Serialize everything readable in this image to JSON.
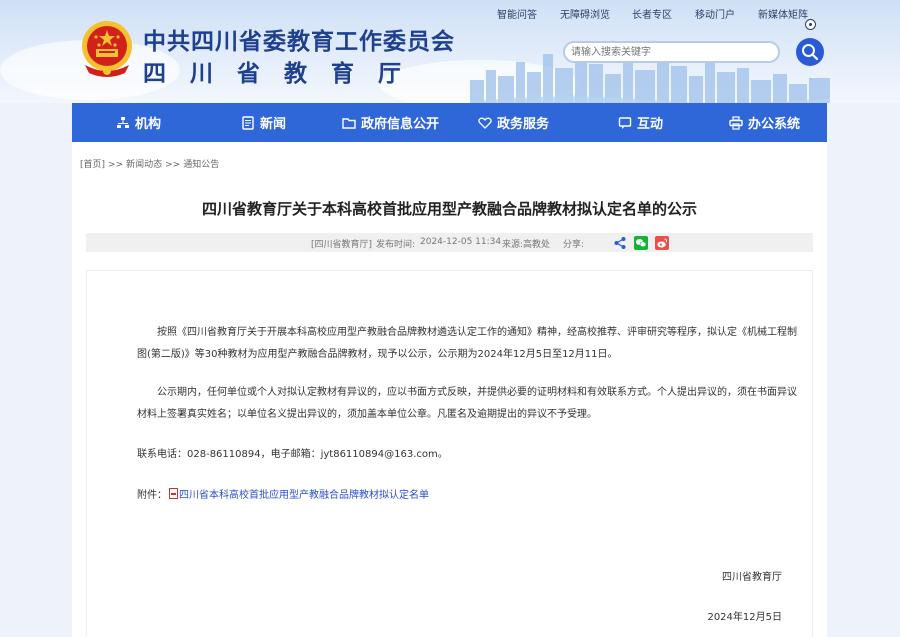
{
  "header": {
    "title": "中共四川省委教育工作委员会",
    "subtitle": "四川省教育厅",
    "top_links": [
      "智能问答",
      "无障碍浏览",
      "长者专区",
      "移动门户",
      "新媒体矩阵"
    ],
    "search_placeholder": "请输入搜索关键字"
  },
  "nav": {
    "items": [
      {
        "label": "机构",
        "icon": "org-icon"
      },
      {
        "label": "新闻",
        "icon": "news-icon"
      },
      {
        "label": "政府信息公开",
        "icon": "folder-icon"
      },
      {
        "label": "政务服务",
        "icon": "service-icon"
      },
      {
        "label": "互动",
        "icon": "chat-icon"
      },
      {
        "label": "办公系统",
        "icon": "printer-icon"
      }
    ]
  },
  "breadcrumb": [
    "[首页]",
    ">>",
    "新闻动态",
    ">>",
    "通知公告"
  ],
  "article": {
    "title": "四川省教育厅关于本科高校首批应用型产教融合品牌教材拟认定名单的公示",
    "source": "[四川省教育厅]",
    "publish_label": "发布时间:",
    "publish_time": "2024-12-05 11:34",
    "origin": "来源:高教处",
    "share_label": "分享:",
    "paragraphs": [
      "按照《四川省教育厅关于开展本科高校应用型产教融合品牌教材遴选认定工作的通知》精神，经高校推荐、评审研究等程序，拟认定《机械工程制图(第二版)》等30种教材为应用型产教融合品牌教材，现予以公示，公示期为2024年12月5日至12月11日。",
      "公示期内，任何单位或个人对拟认定教材有异议的，应以书面方式反映，并提供必要的证明材料和有效联系方式。个人提出异议的，须在书面异议材料上签署真实姓名；以单位名义提出异议的，须加盖本单位公章。凡匿名及逾期提出的异议不予受理。",
      "联系电话：028-86110894，电子邮箱：jyt86110894@163.com。"
    ],
    "attachment_label": "附件：",
    "attachment_link": "四川省本科高校首批应用型产教融合品牌教材拟认定名单",
    "signature": "四川省教育厅",
    "date": "2024年12月5日"
  },
  "colors": {
    "nav_bg": "#2f67d8",
    "title_blue": "#1f3f8f",
    "link_blue": "#2a4fd0",
    "emblem_red": "#d4201a",
    "emblem_gold": "#f3c22e"
  }
}
